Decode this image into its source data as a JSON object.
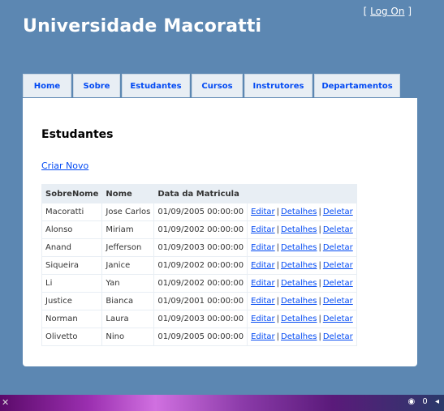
{
  "header": {
    "site_title": "Universidade Macoratti",
    "login_open": "[",
    "login_label": "Log On",
    "login_close": "]"
  },
  "tabs": [
    {
      "label": "Home"
    },
    {
      "label": "Sobre"
    },
    {
      "label": "Estudantes"
    },
    {
      "label": "Cursos"
    },
    {
      "label": "Instrutores"
    },
    {
      "label": "Departamentos"
    }
  ],
  "main": {
    "title": "Estudantes",
    "create_link": "Criar Novo",
    "columns": [
      "SobreNome",
      "Nome",
      "Data da Matricula"
    ],
    "actions": {
      "edit": "Editar",
      "details": "Detalhes",
      "delete": "Deletar",
      "separator": "|"
    },
    "rows": [
      {
        "last": "Macoratti",
        "first": "Jose Carlos",
        "date": "01/09/2005 00:00:00"
      },
      {
        "last": "Alonso",
        "first": "Miriam",
        "date": "01/09/2002 00:00:00"
      },
      {
        "last": "Anand",
        "first": "Jefferson",
        "date": "01/09/2003 00:00:00"
      },
      {
        "last": "Siqueira",
        "first": "Janice",
        "date": "01/09/2002 00:00:00"
      },
      {
        "last": "Li",
        "first": "Yan",
        "date": "01/09/2002 00:00:00"
      },
      {
        "last": "Justice",
        "first": "Bianca",
        "date": "01/09/2001 00:00:00"
      },
      {
        "last": "Norman",
        "first": "Laura",
        "date": "01/09/2003 00:00:00"
      },
      {
        "last": "Olivetto",
        "first": "Nino",
        "date": "01/09/2005 00:00:00"
      }
    ]
  },
  "taskbar": {
    "icons": [
      "start-icon",
      "network-icon",
      "volume-icon"
    ],
    "tray_count": "0"
  },
  "colors": {
    "page_background": "#5c87b2",
    "tab_background": "#e8eef4",
    "link": "#034af3"
  }
}
